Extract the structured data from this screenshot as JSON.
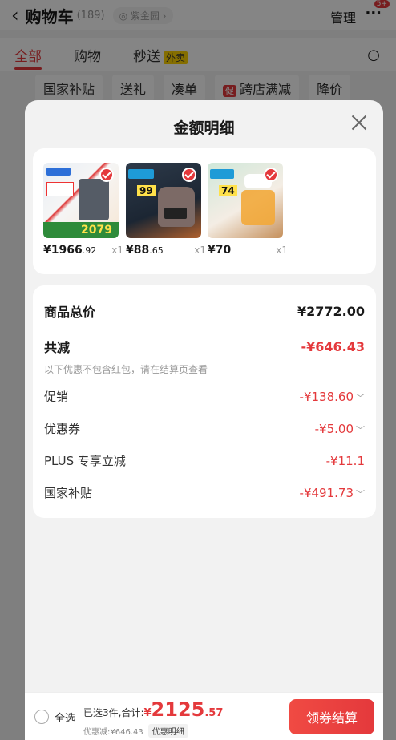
{
  "background": {
    "title": "购物车",
    "count": "(189)",
    "location": "紫金园",
    "manage": "管理",
    "badge": "5+",
    "tabs": [
      "全部",
      "购物",
      "秒送"
    ],
    "waimai": "外卖",
    "chips": [
      "国家补贴",
      "送礼",
      "凑单",
      "跨店满减",
      "降价"
    ],
    "chip_promo_icon": "促"
  },
  "sheet": {
    "title": "金额明细",
    "products": [
      {
        "price_int": "¥1966",
        "price_dec": ".92",
        "qty": "x1",
        "image": "air-fryer",
        "badge_price": "2079"
      },
      {
        "price_int": "¥88",
        "price_dec": ".65",
        "qty": "x1",
        "image": "rice-cooker",
        "badge_price": "99"
      },
      {
        "price_int": "¥70",
        "price_dec": "",
        "qty": "x1",
        "image": "food-chopper",
        "badge_price": "74"
      }
    ],
    "details": {
      "total_label": "商品总价",
      "total_value": "¥2772.00",
      "reduce_label": "共减",
      "reduce_value": "-¥646.43",
      "note": "以下优惠不包含红包，请在结算页查看",
      "items": [
        {
          "label": "促销",
          "value": "-¥138.60",
          "chevron": true
        },
        {
          "label": "优惠券",
          "value": "-¥5.00",
          "chevron": true
        },
        {
          "label": "PLUS 专享立减",
          "value": "-¥11.1",
          "chevron": false
        },
        {
          "label": "国家补贴",
          "value": "-¥491.73",
          "chevron": true
        }
      ]
    }
  },
  "bottom": {
    "select_all": "全选",
    "selected_text": "已选3件,合计:",
    "yen": "¥",
    "total_int": "2125",
    "total_dec": ".57",
    "discount_text": "优惠减:¥646.43",
    "detail_btn": "优惠明细",
    "checkout": "领券结算"
  },
  "colors": {
    "accent": "#e4393c",
    "sheet_bg": "#f2f2f2"
  }
}
